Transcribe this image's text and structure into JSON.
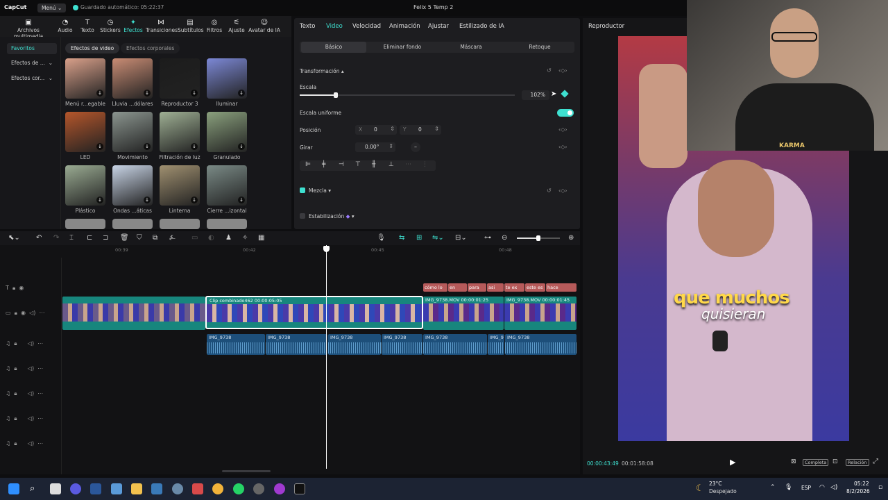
{
  "titlebar": {
    "logo": "CapCut",
    "menu_label": "Menú",
    "autosave": "Guardado automático: 05:22:37",
    "project_title": "Felix 5 Temp 2"
  },
  "toolbar": [
    {
      "label": "Archivos multimedia",
      "icon": "media-icon"
    },
    {
      "label": "Audio",
      "icon": "audio-icon"
    },
    {
      "label": "Texto",
      "icon": "text-icon"
    },
    {
      "label": "Stickers",
      "icon": "sticker-icon"
    },
    {
      "label": "Efectos",
      "icon": "effects-icon"
    },
    {
      "label": "Transiciones",
      "icon": "transitions-icon"
    },
    {
      "label": "Subtítulos",
      "icon": "subtitles-icon"
    },
    {
      "label": "Filtros",
      "icon": "filters-icon"
    },
    {
      "label": "Ajuste",
      "icon": "adjust-icon"
    },
    {
      "label": "Avatar de IA",
      "icon": "ai-avatar-icon"
    }
  ],
  "leftnav": [
    "Favoritos",
    "Efectos de ...",
    "Efectos cor..."
  ],
  "effect_tabs": [
    "Efectos de video",
    "Efectos corporales"
  ],
  "effects": [
    {
      "label": "Menú r...egable",
      "color": "#d9a08a"
    },
    {
      "label": "Lluvia ...dólares",
      "color": "#c98c74"
    },
    {
      "label": "Reproductor 3",
      "color": "#1c1c1c"
    },
    {
      "label": "Iluminar",
      "color": "#7c88d6"
    },
    {
      "label": "LED",
      "color": "#b5562b"
    },
    {
      "label": "Movimiento",
      "color": "#8b958f"
    },
    {
      "label": "Filtración de luz",
      "color": "#9fb094"
    },
    {
      "label": "Granulado",
      "color": "#8aa07d"
    },
    {
      "label": "Plástico",
      "color": "#9aab92"
    },
    {
      "label": "Ondas ...áticas",
      "color": "#c8d4e6"
    },
    {
      "label": "Linterna",
      "color": "#a09070"
    },
    {
      "label": "Cierre ...izontal",
      "color": "#7a8a86"
    }
  ],
  "props": {
    "tabs": [
      "Texto",
      "Video",
      "Velocidad",
      "Animación",
      "Ajustar",
      "Estilizado de IA"
    ],
    "subtabs": [
      "Básico",
      "Eliminar fondo",
      "Máscara",
      "Retoque"
    ],
    "transform_label": "Transformación",
    "scale_label": "Escala",
    "scale_value": "102%",
    "scale_fraction": 0.102,
    "uniform_label": "Escala uniforme",
    "position_label": "Posición",
    "pos_x_label": "X",
    "pos_x": "0",
    "pos_y_label": "Y",
    "pos_y": "0",
    "rotate_label": "Girar",
    "rotate_value": "0.00°",
    "blend_label": "Mezcla",
    "stabilize_label": "Estabilización"
  },
  "player": {
    "title": "Reproductor",
    "current_time": "00:00:43:49",
    "total_time": "00:01:58:08",
    "caption_line1": "que muchos",
    "caption_line2": "quisieran",
    "overlay_text": "KARMA",
    "complete_label": "Completa",
    "ratio_label": "Relación"
  },
  "timeline": {
    "ruler": [
      "00:39",
      "00:42",
      "00:45",
      "00:48"
    ],
    "compound_clip": "Clip combinado462  00:00:05:05",
    "clip2": "IMG_9738.MOV  00:00:01:25",
    "clip3": "IMG_9738.MOV  00:00:01:45",
    "text_clips": [
      "cómo lo",
      "en",
      "para",
      "asi",
      "te ex",
      "este es",
      "hace"
    ],
    "audio_clips": [
      "IMG_9738",
      "IMG_9738",
      "IMG_9738",
      "IMG_9738",
      "IMG_9738",
      "IMG_97",
      "IMG_9738"
    ]
  },
  "taskbar": {
    "weather_temp": "23°C",
    "weather_desc": "Despejado",
    "lang": "ESP",
    "time": "05:22",
    "date": "8/2/2026"
  },
  "colors": {
    "accent": "#3ee0d0",
    "clip_teal": "#17867d",
    "audio_blue": "#1d4f7a",
    "text_clip": "#b65a5a"
  }
}
